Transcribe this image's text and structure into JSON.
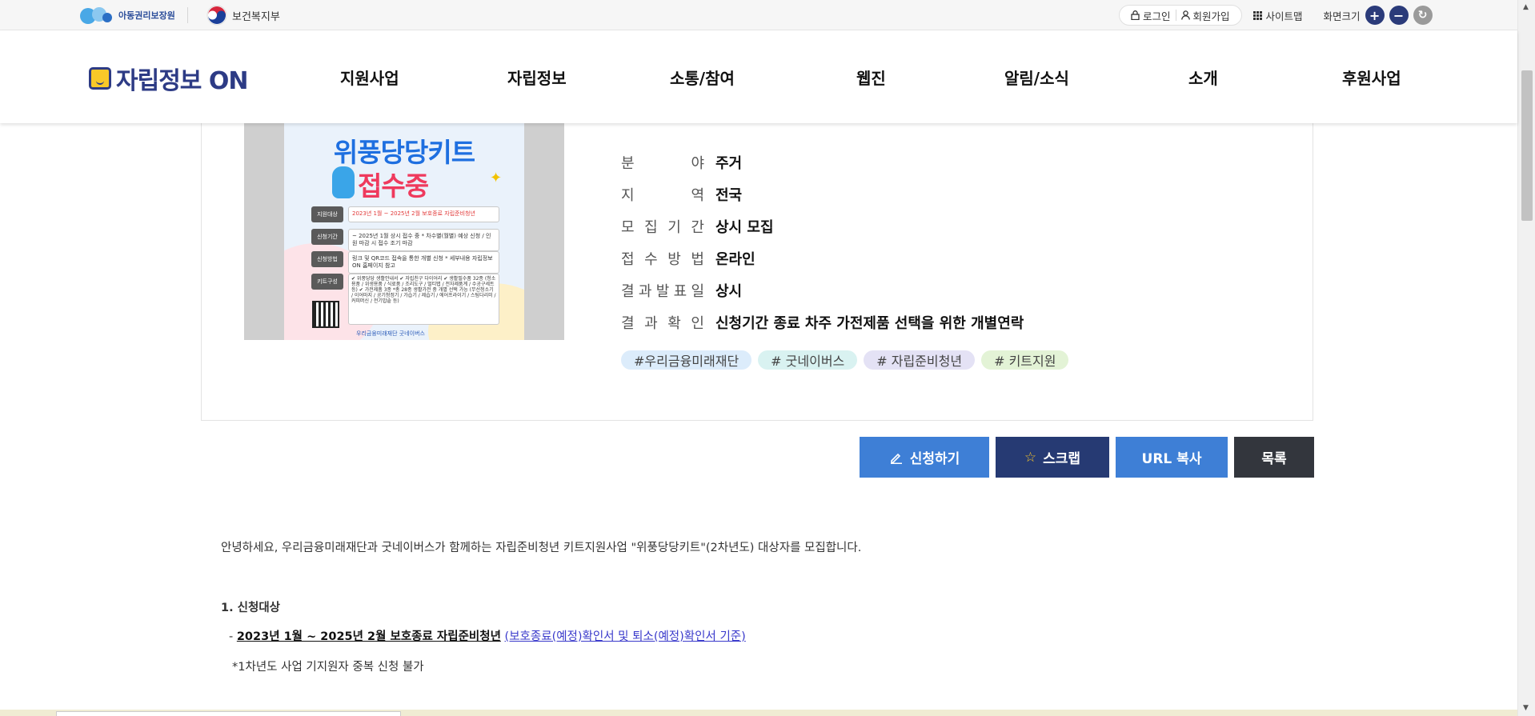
{
  "topbar": {
    "org1": "아동권리보장원",
    "org2": "보건복지부",
    "login": "로그인",
    "signup": "회원가입",
    "sitemap": "사이트맵",
    "font_size": "화면크기",
    "plus": "+",
    "minus": "−",
    "reset": "↻"
  },
  "header": {
    "logo": "자립정보 ON",
    "nav": [
      "지원사업",
      "자립정보",
      "소통/참여",
      "웹진",
      "알림/소식",
      "소개",
      "후원사업"
    ]
  },
  "poster": {
    "title1": "위풍당당키트",
    "title2": "접수중",
    "rows": [
      {
        "label": "지원대상",
        "text": "2023년 1월 ~ 2025년 2월 보호종료 자립준비청년"
      },
      {
        "label": "신청기간",
        "text": "~ 2025년 1월 상시 접수 중 * 차수별(월별) 예상 신청 / 인원 마감 시 접수 조기 마감"
      },
      {
        "label": "신청방법",
        "text": "링크 및 QR코드 접속을 통한 개별 신청 * 세부내용 자립정보ON 홈페이지 참고"
      },
      {
        "label": "키트구성",
        "text": "✔ 위풍당당 생활안내서 ✔ 자립친구 다이어리 ✔ 생활필수품 32종 (청소용품 / 위생용품 / 식료품 / 조리도구 / 멀티탭 / 전자제품계 / 수공구세트 등) ✔ 가전제품 3종 *총 28종 생활가전 중 개별 선택 가능 (무선청소기 / 이어마지 / 공기청정기 / 가습기 / 제습기 / 에어프라이기 / 스팀다리미 / 커피머신 / 전기밥솥 등)"
      }
    ],
    "footer": "우리금융미래재단   굿네이버스"
  },
  "info": [
    {
      "label": "분야",
      "value": "주거"
    },
    {
      "label": "지역",
      "value": "전국"
    },
    {
      "label": "모집기간",
      "value": "상시 모집"
    },
    {
      "label": "접수방법",
      "value": "온라인"
    },
    {
      "label": "결과발표일",
      "value": "상시"
    },
    {
      "label": "결과확인",
      "value": "신청기간 종료 차주 가전제품 선택을 위한 개별연락"
    }
  ],
  "tags": [
    "#우리금융미래재단",
    "# 굿네이버스",
    "# 자립준비청년",
    "# 키트지원"
  ],
  "buttons": {
    "apply": "신청하기",
    "scrap": "스크랩",
    "url": "URL 복사",
    "list": "목록"
  },
  "content": {
    "intro": "안녕하세요, 우리금융미래재단과 굿네이버스가 함께하는 자립준비청년 키트지원사업 \"위풍당당키트\"(2차년도) 대상자를 모집합니다.",
    "section1_title": "1. 신청대상",
    "item1_prefix": "- ",
    "item1_bold": "2023년 1월 ~ 2025년 2월 보호종료 자립준비청년",
    "item1_link": "(보호종료(예정)확인서 및 퇴소(예정)확인서 기준)",
    "item2": "*1차년도 사업 기지원자 중복 신청 불가"
  },
  "colors": {
    "brand_navy": "#2d3b85",
    "apply_blue": "#3e7fd6",
    "scrap_navy": "#263a73",
    "list_dark": "#33363d"
  }
}
